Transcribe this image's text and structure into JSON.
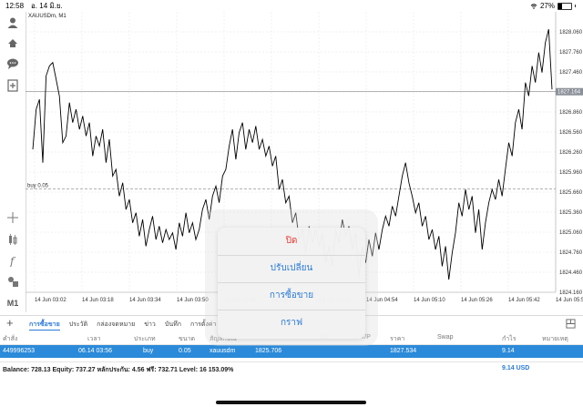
{
  "status_bar": {
    "time": "12:58",
    "date": "อ. 14 มิ.ย.",
    "battery": "27%"
  },
  "chart": {
    "symbol": "XAUUSDm, M1",
    "buy_label": "buy 0.05",
    "current_price": "1827.164"
  },
  "chart_data": {
    "type": "line",
    "symbol": "XAUUSDm, M1",
    "y_ticks": [
      "1828.060",
      "1827.760",
      "1827.460",
      "1827.160",
      "1826.860",
      "1826.560",
      "1826.260",
      "1825.960",
      "1825.660",
      "1825.360",
      "1825.060",
      "1824.760",
      "1824.460",
      "1824.160"
    ],
    "x_ticks": [
      "14 Jun 03:02",
      "14 Jun 03:18",
      "14 Jun 03:34",
      "14 Jun 03:50",
      "14 Jun 04:06",
      "14 Jun 04:22",
      "14 Jun 04:38",
      "14 Jun 04:54",
      "14 Jun 05:10",
      "14 Jun 05:26",
      "14 Jun 05:42",
      "14 Jun 05:58"
    ],
    "ylim": [
      1824.16,
      1828.36
    ],
    "current_price": 1827.164,
    "buy_level": 1825.706,
    "series": [
      {
        "values": [
          1826.3,
          1826.9,
          1827.05,
          1826.1,
          1827.4,
          1827.55,
          1827.6,
          1827.35,
          1827.1,
          1826.4,
          1826.5,
          1827.0,
          1826.7,
          1826.9,
          1826.6,
          1826.8,
          1826.5,
          1826.7,
          1826.2,
          1826.5,
          1826.35,
          1826.6,
          1826.1,
          1826.45,
          1825.9,
          1826.0,
          1825.6,
          1825.8,
          1825.4,
          1825.55,
          1825.2,
          1825.35,
          1825.0,
          1825.25,
          1824.85,
          1825.1,
          1825.3,
          1824.95,
          1825.15,
          1824.9,
          1825.1,
          1824.95,
          1825.05,
          1824.8,
          1825.2,
          1825.0,
          1825.35,
          1825.05,
          1825.2,
          1824.95,
          1825.1,
          1825.4,
          1825.55,
          1825.25,
          1825.6,
          1825.75,
          1825.5,
          1825.9,
          1826.0,
          1826.35,
          1826.6,
          1826.15,
          1826.55,
          1826.7,
          1826.3,
          1826.6,
          1826.4,
          1826.65,
          1826.3,
          1826.45,
          1826.2,
          1826.35,
          1826.05,
          1826.2,
          1825.7,
          1825.85,
          1825.5,
          1825.6,
          1825.2,
          1825.35,
          1824.95,
          1825.1,
          1824.75,
          1825.15,
          1824.9,
          1825.1,
          1824.85,
          1825.05,
          1824.6,
          1824.85,
          1824.55,
          1825.1,
          1824.9,
          1825.25,
          1825.0,
          1825.15,
          1824.8,
          1825.05,
          1824.4,
          1824.85,
          1824.6,
          1824.95,
          1824.7,
          1825.05,
          1824.8,
          1825.1,
          1825.3,
          1825.15,
          1825.45,
          1825.3,
          1825.6,
          1825.9,
          1826.1,
          1825.8,
          1825.6,
          1825.35,
          1825.5,
          1825.15,
          1825.3,
          1824.95,
          1825.1,
          1824.8,
          1825.0,
          1824.55,
          1824.85,
          1824.35,
          1824.75,
          1825.05,
          1825.5,
          1825.3,
          1825.7,
          1825.4,
          1825.6,
          1825.05,
          1825.4,
          1824.8,
          1825.2,
          1825.5,
          1825.7,
          1825.55,
          1825.85,
          1825.6,
          1826.0,
          1826.4,
          1826.2,
          1826.7,
          1826.9,
          1826.6,
          1827.3,
          1827.1,
          1827.55,
          1827.3,
          1827.75,
          1827.45,
          1827.9,
          1828.1,
          1827.2
        ]
      }
    ]
  },
  "tabs": {
    "plus": "+",
    "items": [
      {
        "label": "การซื้อขาย",
        "active": true
      },
      {
        "label": "ประวัติ",
        "active": false
      },
      {
        "label": "กล่องจดหมาย",
        "active": false
      },
      {
        "label": "ข่าว",
        "active": false
      },
      {
        "label": "บันทึก",
        "active": false
      },
      {
        "label": "การตั้งค่า",
        "active": false
      }
    ]
  },
  "table": {
    "headers": {
      "order": "คำสั่ง",
      "time": "เวลา",
      "type": "ประเภท",
      "size": "ขนาด",
      "symbol": "สัญลักษณ์",
      "sl": "S/L",
      "tp": "T/P",
      "price": "ราคา",
      "swap": "Swap",
      "profit": "กำไร",
      "comment": "หมายเหตุ"
    },
    "row": {
      "order": "449996253",
      "time": "06.14 03:56",
      "type": "buy",
      "size": "0.05",
      "symbol": "xauusdm",
      "open_price": "1825.706",
      "price": "1827.534",
      "profit": "9.14"
    }
  },
  "balance": {
    "text": "Balance: 728.13 Equity: 737.27 หลักประกัน: 4.56 ฟรี: 732.71 Level: 16 153.09%",
    "profit": "9.14  USD"
  },
  "popup": {
    "close": "ปิด",
    "modify": "ปรับเปลี่ยน",
    "trade": "การซื้อขาย",
    "chart": "กราฟ"
  },
  "colors": {
    "accent": "#2b7bd6",
    "selected_row": "#2b8ad9",
    "danger": "#e53935",
    "chart_line": "#000000",
    "grid": "#e6e6e6"
  }
}
